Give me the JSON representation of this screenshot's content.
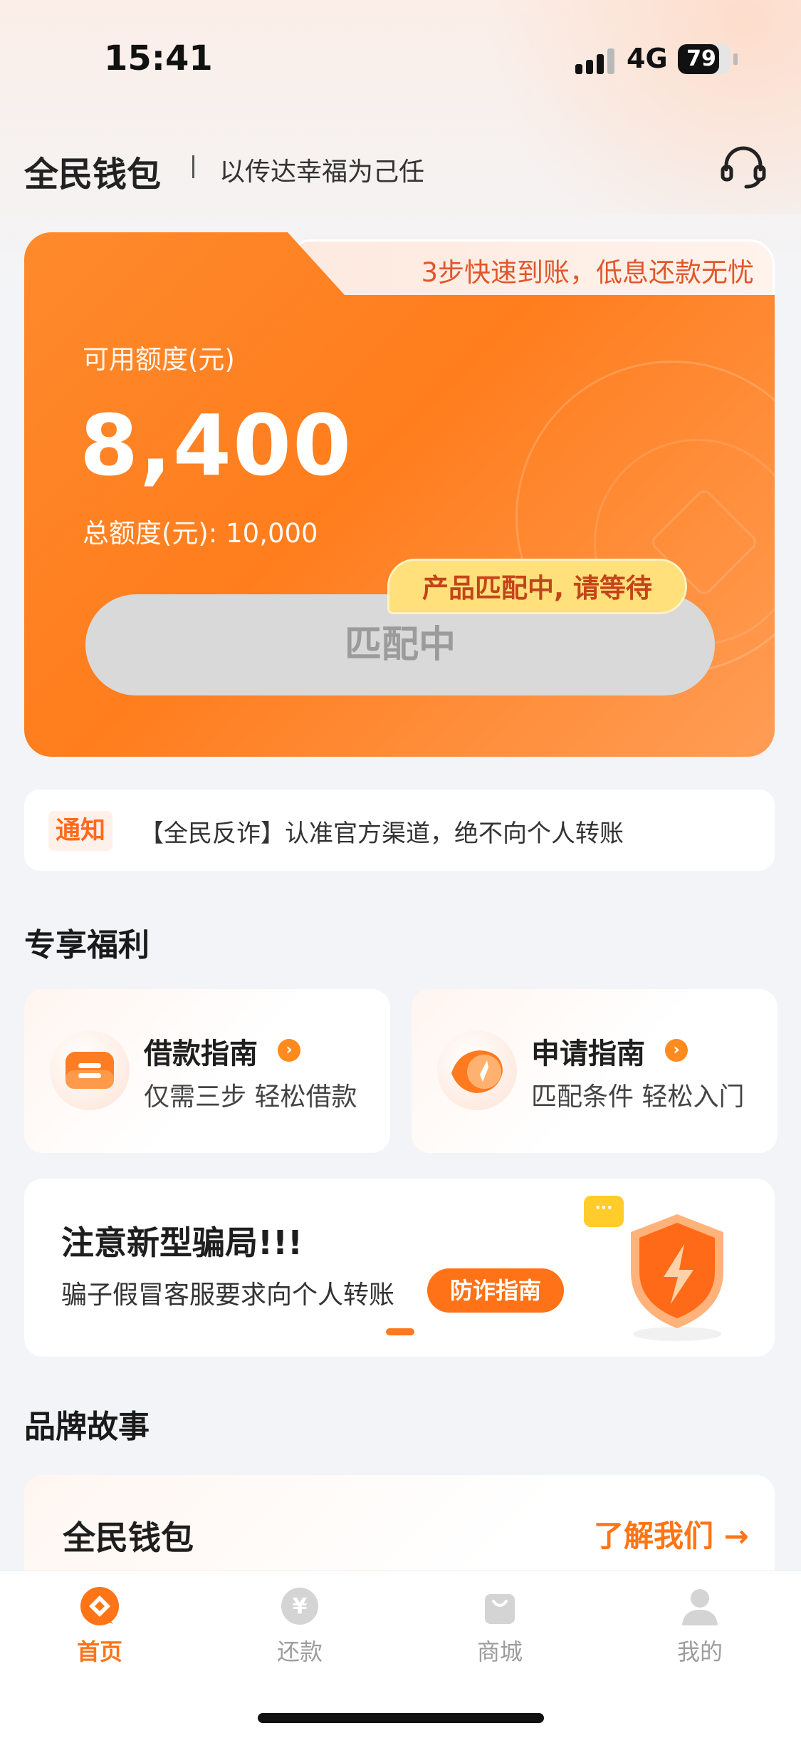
{
  "status_bar": {
    "time": "15:41",
    "network": "4G",
    "battery": "79",
    "battery_level": 0.79
  },
  "header": {
    "title": "全民钱包",
    "slogan": "以传达幸福为己任"
  },
  "credit_card": {
    "promo": "3步快速到账，低息还款无忧",
    "available_label": "可用额度(元)",
    "available_amount": "8,400",
    "total_label": "总额度(元): ",
    "total_value": "10,000",
    "button_label": "匹配中",
    "tip": "产品匹配中, 请等待"
  },
  "notice": {
    "badge": "通知",
    "text": "【全民反诈】认准官方渠道，绝不向个人转账"
  },
  "benefits": {
    "section_title": "专享福利",
    "items": [
      {
        "title": "借款指南",
        "desc": "仅需三步 轻松借款"
      },
      {
        "title": "申请指南",
        "desc": "匹配条件 轻松入门"
      }
    ]
  },
  "banner": {
    "title": "注意新型骗局!!!",
    "desc": "骗子假冒客服要求向个人转账",
    "button": "防诈指南"
  },
  "brand": {
    "section_title": "品牌故事",
    "name": "全民钱包",
    "link": "了解我们 →",
    "sub": ""
  },
  "tabs": [
    {
      "label": "首页",
      "icon": "home-icon",
      "active": true
    },
    {
      "label": "还款",
      "icon": "repay-icon",
      "active": false
    },
    {
      "label": "商城",
      "icon": "shop-icon",
      "active": false
    },
    {
      "label": "我的",
      "icon": "profile-icon",
      "active": false
    }
  ],
  "colors": {
    "accent": "#ff7416",
    "card": "#ff8a2c",
    "tip": "#ffe07a"
  }
}
